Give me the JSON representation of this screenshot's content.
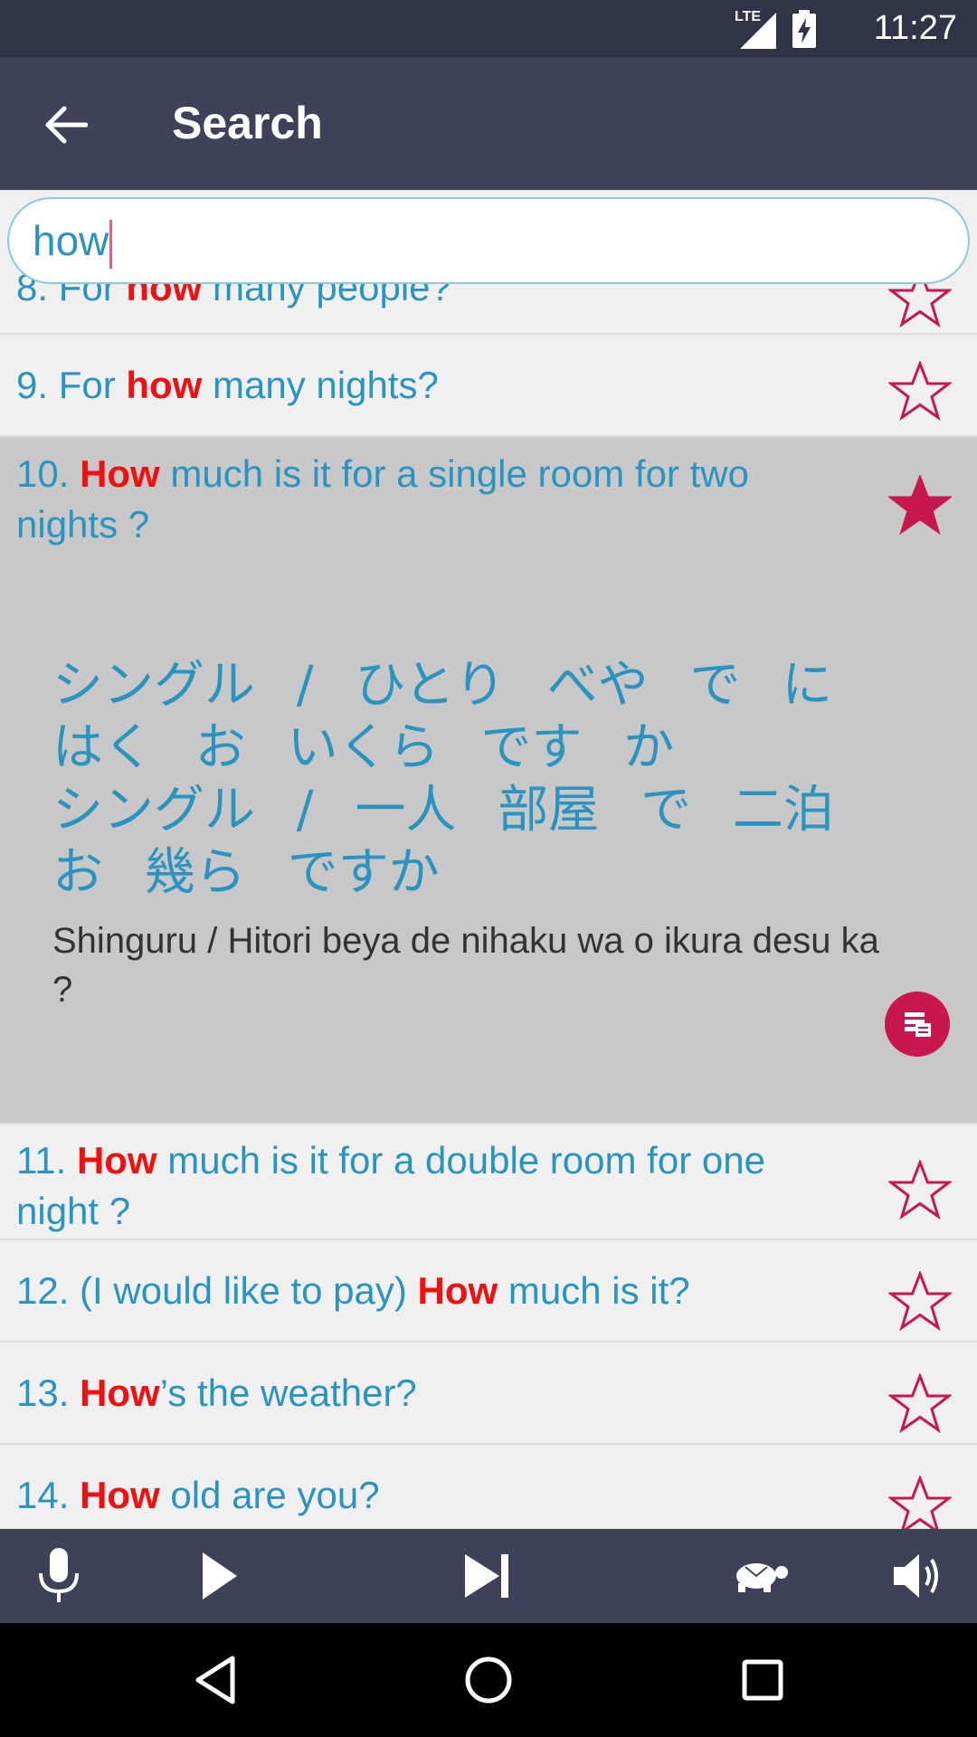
{
  "status_bar": {
    "network": "LTE",
    "time": "11:27"
  },
  "app_bar": {
    "title": "Search"
  },
  "search": {
    "query": "how"
  },
  "results": [
    {
      "prefix": "8. For ",
      "highlight": "how",
      "suffix": " many people?",
      "starred": false
    },
    {
      "prefix": "9. For ",
      "highlight": "how",
      "suffix": " many nights?",
      "starred": false
    },
    {
      "prefix": "10. ",
      "highlight": "How",
      "suffix": " much is it for a single room for two nights ?",
      "starred": true,
      "japanese_kana": "シングル / ひとり べや で に はく お いくら です か",
      "japanese_kanji": "シングル / 一人 部屋 で 二泊 お 幾ら ですか",
      "romaji": "Shinguru / Hitori beya de nihaku wa o ikura desu ka ?"
    },
    {
      "prefix": "11. ",
      "highlight": "How",
      "suffix": " much is it for a double room for one night ?",
      "starred": false
    },
    {
      "prefix": "12. (I would like to pay) ",
      "highlight": "How",
      "suffix": " much is it?",
      "starred": false
    },
    {
      "prefix": "13. ",
      "highlight": "How",
      "suffix": "’s the weather?",
      "starred": false
    },
    {
      "prefix": "14. ",
      "highlight": "How",
      "suffix": " old are you?",
      "starred": false
    }
  ],
  "colors": {
    "accent": "#c8174f",
    "phrase_text": "#2a94c0",
    "highlight": "#ee1111",
    "bar": "#3e4259"
  }
}
